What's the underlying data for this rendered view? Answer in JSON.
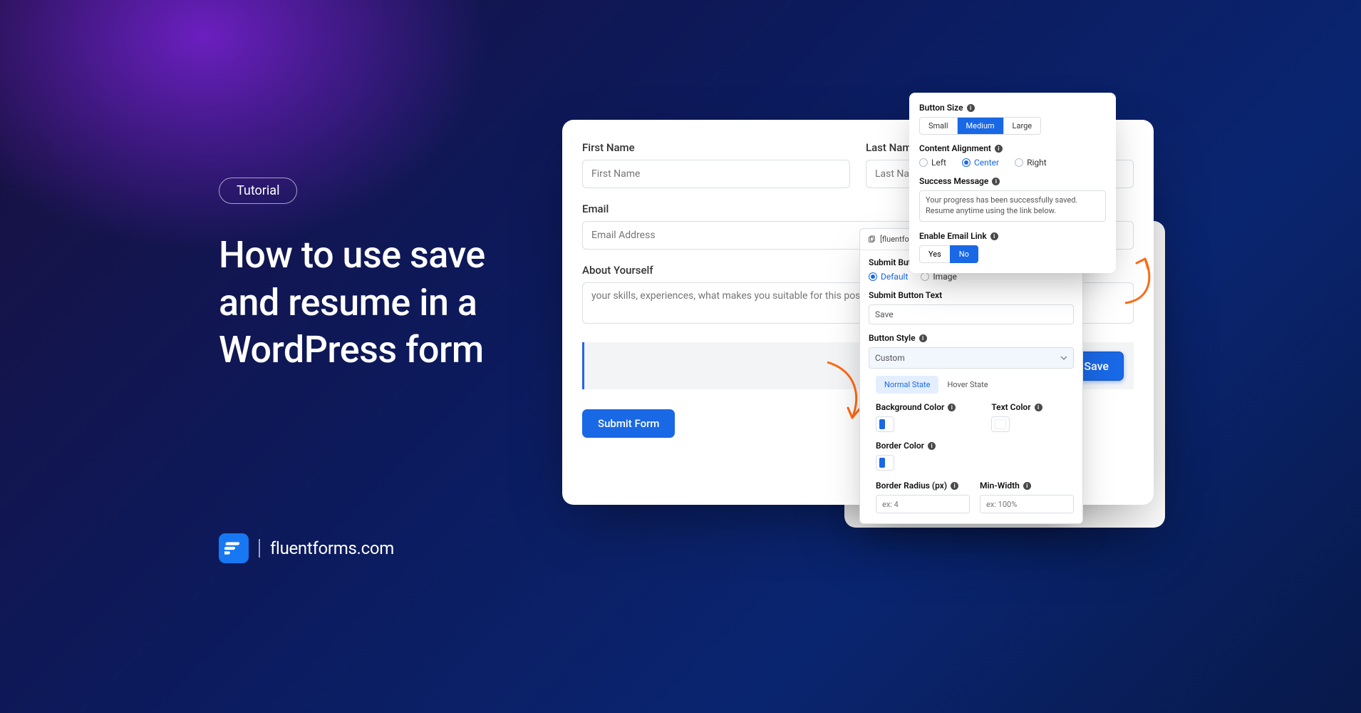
{
  "badge": "Tutorial",
  "headline_l1": "How to use save",
  "headline_l2": "and resume in a",
  "headline_l3": "WordPress form",
  "brand": "fluentforms.com",
  "form": {
    "first_name": {
      "label": "First Name",
      "placeholder": "First Name"
    },
    "last_name": {
      "label": "Last Name",
      "placeholder": "Last Name"
    },
    "email": {
      "label": "Email",
      "placeholder": "Email Address"
    },
    "about": {
      "label": "About Yourself",
      "placeholder": "your skills, experiences, what makes you suitable for this position, etc"
    },
    "save_label": "Save",
    "submit_label": "Submit Form"
  },
  "settings": {
    "header_chip": "[fluentform",
    "submit_button_label": "Submit Button",
    "submit_options": {
      "default": "Default",
      "image": "Image",
      "selected": "default"
    },
    "submit_text_label": "Submit Button Text",
    "submit_text_value": "Save",
    "button_style_label": "Button Style",
    "button_style_value": "Custom",
    "state_tabs": {
      "normal": "Normal State",
      "hover": "Hover State",
      "active": "normal"
    },
    "bg_color_label": "Background Color",
    "text_color_label": "Text Color",
    "border_color_label": "Border Color",
    "colors": {
      "bg": "#1968e5",
      "text": "#ffffff",
      "border": "#1968e5"
    },
    "radius_label": "Border Radius (px)",
    "radius_ph": "ex: 4",
    "minw_label": "Min-Width",
    "minw_ph": "ex: 100%"
  },
  "top_panel": {
    "size_label": "Button Size",
    "sizes": {
      "small": "Small",
      "medium": "Medium",
      "large": "Large",
      "active": "medium"
    },
    "align_label": "Content Alignment",
    "align": {
      "left": "Left",
      "center": "Center",
      "right": "Right",
      "selected": "center"
    },
    "success_label": "Success Message",
    "success_value": "Your progress has been successfully saved. Resume anytime using the link below.",
    "email_link_label": "Enable Email Link",
    "yn": {
      "yes": "Yes",
      "no": "No",
      "active": "no"
    }
  }
}
